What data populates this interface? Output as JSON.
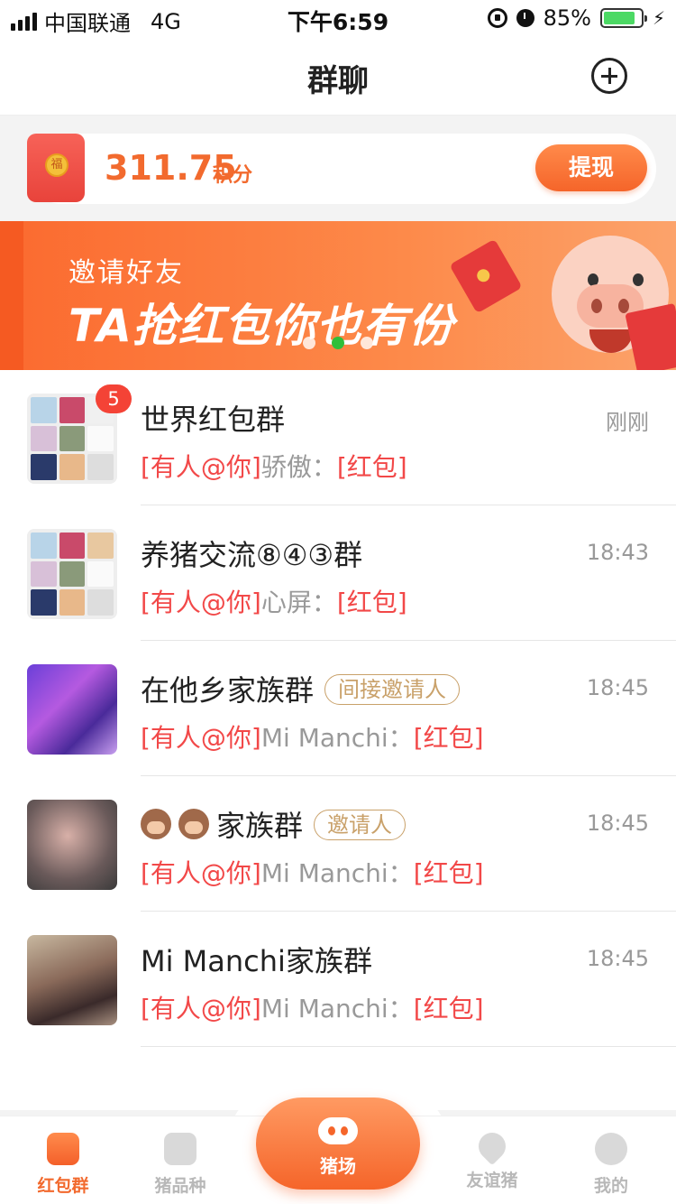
{
  "status_bar": {
    "carrier": "中国联通",
    "network": "4G",
    "time": "下午6:59",
    "battery_percent": "85%",
    "battery_level": 0.85
  },
  "nav": {
    "title": "群聊",
    "add_icon": "plus-circle-icon"
  },
  "points": {
    "value": "311.75",
    "unit": "积分",
    "withdraw_label": "提现",
    "coin_glyph": "福"
  },
  "banner": {
    "subtitle": "邀请好友",
    "title": "TA抢红包你也有份",
    "active_slide": 2,
    "slide_count": 3
  },
  "chats": [
    {
      "name": "世界红包群",
      "time": "刚刚",
      "badge": "5",
      "mention": "[有人@你]",
      "sender": "骄傲：",
      "content": "[红包]"
    },
    {
      "name": "养猪交流⑧④③群",
      "time": "18:43",
      "mention": "[有人@你]",
      "sender": "心屏：",
      "content": "[红包]"
    },
    {
      "name": "在他乡家族群",
      "tag": "间接邀请人",
      "time": "18:45",
      "mention": "[有人@你]",
      "sender": "Mi Manchi：",
      "content": "[红包]"
    },
    {
      "name": "家族群",
      "tag": "邀请人",
      "time": "18:45",
      "mention": "[有人@你]",
      "sender": "Mi Manchi：",
      "content": "[红包]"
    },
    {
      "name": "Mi Manchi家族群",
      "time": "18:45",
      "mention": "[有人@你]",
      "sender": "Mi Manchi：",
      "content": "[红包]"
    }
  ],
  "tabbar": {
    "tabs": [
      {
        "label": "红包群",
        "icon": "red-envelope-icon",
        "active": true
      },
      {
        "label": "猪品种",
        "icon": "list-icon"
      },
      {
        "label": "猪场",
        "icon": "pig-face-icon"
      },
      {
        "label": "友谊猪",
        "icon": "heart-icon"
      },
      {
        "label": "我的",
        "icon": "smile-icon"
      }
    ]
  },
  "colors": {
    "accent": "#f26a2e",
    "mention_red": "#f24848",
    "tag_gold": "#c9a16a",
    "indicator_active": "#2fbf3a"
  }
}
